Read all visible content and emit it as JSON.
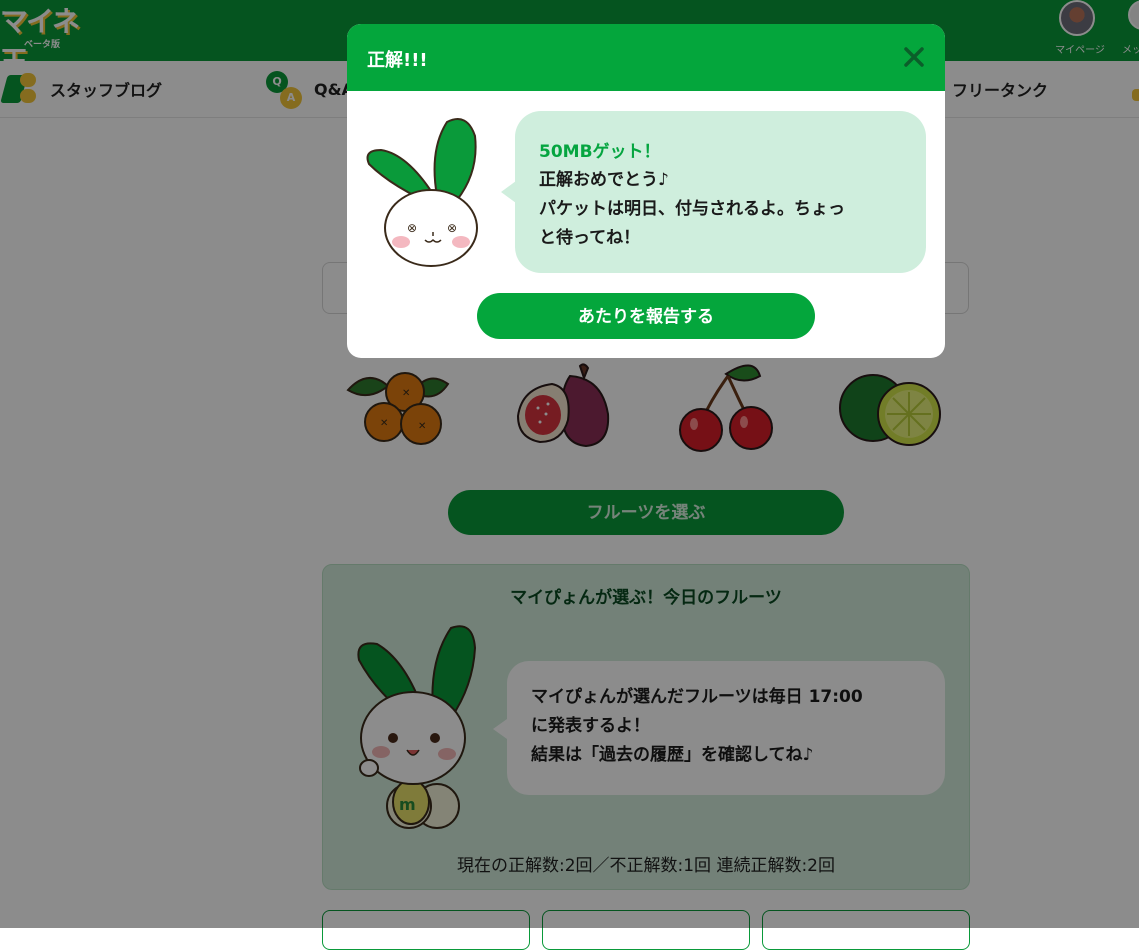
{
  "header": {
    "logo_text": "マイネ王",
    "logo_sub": "ベータ版",
    "mypage_label": "マイページ",
    "messages_label": "メッ"
  },
  "nav": {
    "items": [
      {
        "label": "スタッフブログ",
        "icon": "pen-chat-icon"
      },
      {
        "label": "Q&A",
        "icon": "qa-icon"
      },
      {
        "label": "フリータンク",
        "icon": "tank-icon"
      }
    ]
  },
  "fruits": [
    {
      "name": "orange",
      "icon": "orange-icon"
    },
    {
      "name": "fig",
      "icon": "fig-icon"
    },
    {
      "name": "cherry",
      "icon": "cherry-icon"
    },
    {
      "name": "lime",
      "icon": "lime-icon"
    }
  ],
  "pick_button_label": "フルーツを選ぶ",
  "info_panel": {
    "title": "マイぴょんが選ぶ！今日のフルーツ",
    "bubble_text": "マイぴょんが選んだフルーツは毎日 17:00\nに発表するよ！\n結果は「過去の履歴」を確認してね♪",
    "score_line": "現在の正解数:2回／不正解数:1回 連続正解数:2回"
  },
  "modal": {
    "title": "正解!!!",
    "bubble_head": "50MBゲット！",
    "bubble_body": "正解おめでとう♪\nパケットは明日、付与されるよ。ちょっ\nと待ってね！",
    "report_button_label": "あたりを報告する"
  },
  "colors": {
    "brand_green": "#0a9a3a",
    "modal_green": "#04a63c",
    "bubble_mint": "#cfeedd",
    "accent_yellow": "#f3c53a"
  }
}
